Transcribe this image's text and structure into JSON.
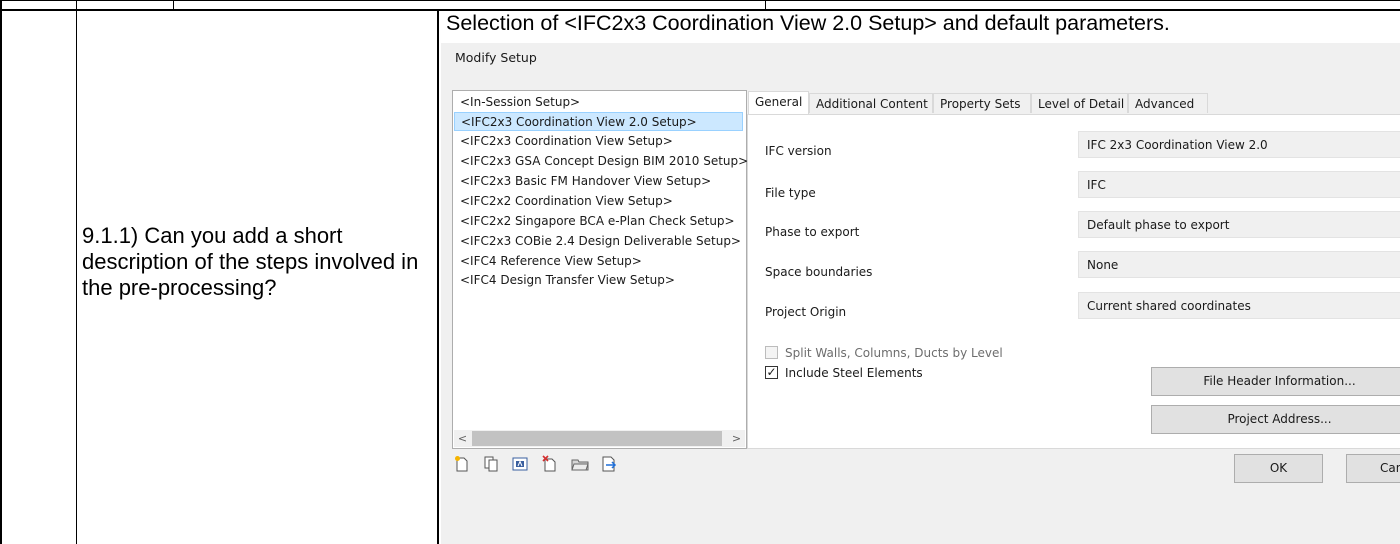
{
  "question": "9.1.1) Can you add a short description of the steps involved in the pre-processing?",
  "caption": "Selection of <IFC2x3 Coordination View 2.0 Setup> and default parameters.",
  "dialog": {
    "title": "Modify Setup",
    "setups": [
      {
        "label": "<In-Session Setup>",
        "selected": false
      },
      {
        "label": "<IFC2x3 Coordination View 2.0 Setup>",
        "selected": true
      },
      {
        "label": "<IFC2x3 Coordination View Setup>",
        "selected": false
      },
      {
        "label": "<IFC2x3 GSA Concept Design BIM 2010 Setup>",
        "selected": false
      },
      {
        "label": "<IFC2x3 Basic FM Handover View Setup>",
        "selected": false
      },
      {
        "label": "<IFC2x2 Coordination View Setup>",
        "selected": false
      },
      {
        "label": "<IFC2x2 Singapore BCA e-Plan Check Setup>",
        "selected": false
      },
      {
        "label": "<IFC2x3 COBie 2.4 Design Deliverable Setup>",
        "selected": false
      },
      {
        "label": "<IFC4 Reference View Setup>",
        "selected": false
      },
      {
        "label": "<IFC4 Design Transfer View Setup>",
        "selected": false
      }
    ],
    "tabs": [
      "General",
      "Additional Content",
      "Property Sets",
      "Level of Detail",
      "Advanced"
    ],
    "active_tab": "General",
    "fields": [
      {
        "label": "IFC version",
        "value": "IFC 2x3 Coordination View 2.0"
      },
      {
        "label": "File type",
        "value": "IFC"
      },
      {
        "label": "Phase to export",
        "value": "Default phase to export"
      },
      {
        "label": "Space boundaries",
        "value": "None"
      },
      {
        "label": "Project Origin",
        "value": "Current shared coordinates"
      }
    ],
    "split_walls": {
      "label": "Split Walls, Columns, Ducts by Level",
      "checked": false,
      "enabled": false
    },
    "include_steel": {
      "label": "Include Steel Elements",
      "checked": true,
      "check_mark": "✓"
    },
    "file_header_button": "File Header Information...",
    "project_address_button": "Project Address...",
    "ok_button": "OK",
    "cancel_button": "Canc",
    "scroll_left": "<",
    "scroll_right": ">"
  },
  "toolbar_icons": [
    "new-setup-icon",
    "duplicate-setup-icon",
    "rename-setup-icon",
    "delete-setup-icon",
    "import-setup-icon",
    "export-setup-icon"
  ]
}
